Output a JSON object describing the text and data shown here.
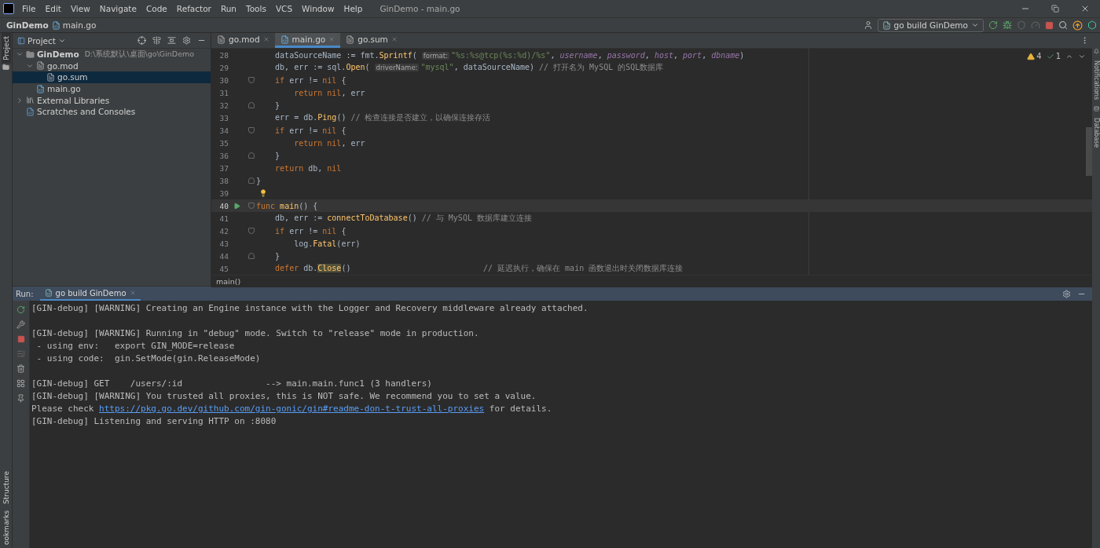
{
  "menu_bar": {
    "items": [
      "File",
      "Edit",
      "View",
      "Navigate",
      "Code",
      "Refactor",
      "Run",
      "Tools",
      "VCS",
      "Window",
      "Help"
    ],
    "title": "GinDemo - main.go"
  },
  "nav_bar": {
    "breadcrumbs": [
      "GinDemo",
      "main.go"
    ],
    "run_config": "go build GinDemo"
  },
  "left_strip": {
    "top": [
      {
        "label": "Project",
        "selected": true
      }
    ],
    "bottom": [
      {
        "label": "Structure",
        "selected": false
      },
      {
        "label": "ookmarks",
        "selected": false
      }
    ]
  },
  "right_strip": [
    {
      "label": "Notifications",
      "kind": "bell"
    },
    {
      "label": "Database",
      "kind": "database"
    }
  ],
  "project_panel": {
    "title": "Project",
    "tree": [
      {
        "label": "GinDemo",
        "path": "D:\\系统默认\\桌面\\go\\GinDemo",
        "kind": "folder",
        "expanded": true,
        "selected": false,
        "bold": true,
        "children": [
          {
            "label": "go.mod",
            "kind": "mod",
            "expanded": true,
            "selected": false,
            "bold": false,
            "children": [
              {
                "label": "go.sum",
                "kind": "mod",
                "selected": true,
                "bold": false
              }
            ]
          },
          {
            "label": "main.go",
            "kind": "gofile",
            "selected": false,
            "bold": false
          }
        ]
      },
      {
        "label": "External Libraries",
        "kind": "library",
        "expanded": false,
        "selected": false,
        "bold": false
      },
      {
        "label": "Scratches and Consoles",
        "kind": "scratch",
        "selected": false,
        "bold": false
      }
    ]
  },
  "editor": {
    "tabs": [
      {
        "label": "go.mod",
        "kind": "mod",
        "selected": false
      },
      {
        "label": "main.go",
        "kind": "gofile",
        "selected": true
      },
      {
        "label": "go.sum",
        "kind": "mod",
        "selected": false
      }
    ],
    "warnings": "4",
    "passed": "1",
    "breadcrumb": "main()",
    "lines": [
      {
        "number": "28",
        "tokens": [
          {
            "kind": "plain",
            "text": "    dataSourceName := fmt."
          },
          {
            "kind": "function",
            "text": "Sprintf"
          },
          {
            "kind": "plain",
            "text": "( "
          },
          {
            "kind": "hint",
            "text": "format:"
          },
          {
            "kind": "string",
            "text": "\"%s:%s@tcp(%s:%d)/%s\""
          },
          {
            "kind": "plain",
            "text": ", "
          },
          {
            "kind": "param",
            "text": "username"
          },
          {
            "kind": "plain",
            "text": ", "
          },
          {
            "kind": "param",
            "text": "password"
          },
          {
            "kind": "plain",
            "text": ", "
          },
          {
            "kind": "param",
            "text": "host"
          },
          {
            "kind": "plain",
            "text": ", "
          },
          {
            "kind": "param",
            "text": "port"
          },
          {
            "kind": "plain",
            "text": ", "
          },
          {
            "kind": "param",
            "text": "dbname"
          },
          {
            "kind": "plain",
            "text": ")"
          }
        ]
      },
      {
        "number": "29",
        "tokens": [
          {
            "kind": "plain",
            "text": "    db, err := sql."
          },
          {
            "kind": "function",
            "text": "Open"
          },
          {
            "kind": "plain",
            "text": "( "
          },
          {
            "kind": "hint",
            "text": "driverName:"
          },
          {
            "kind": "string",
            "text": "\"mysql\""
          },
          {
            "kind": "plain",
            "text": ", dataSourceName) "
          },
          {
            "kind": "comment",
            "text": "// 打开名为 MySQL 的SQL数据库"
          }
        ]
      },
      {
        "number": "30",
        "fold_start": true,
        "tokens": [
          {
            "kind": "keyword",
            "text": "    if"
          },
          {
            "kind": "plain",
            "text": " err != "
          },
          {
            "kind": "keyword",
            "text": "nil"
          },
          {
            "kind": "plain",
            "text": " {"
          }
        ]
      },
      {
        "number": "31",
        "tokens": [
          {
            "kind": "keyword",
            "text": "        return nil"
          },
          {
            "kind": "plain",
            "text": ", err"
          }
        ]
      },
      {
        "number": "32",
        "fold_end": true,
        "tokens": [
          {
            "kind": "plain",
            "text": "    }"
          }
        ]
      },
      {
        "number": "33",
        "tokens": [
          {
            "kind": "plain",
            "text": "    err = db."
          },
          {
            "kind": "function",
            "text": "Ping"
          },
          {
            "kind": "plain",
            "text": "() "
          },
          {
            "kind": "comment",
            "text": "// 检查连接是否建立，以确保连接存活"
          }
        ]
      },
      {
        "number": "34",
        "fold_start": true,
        "tokens": [
          {
            "kind": "keyword",
            "text": "    if"
          },
          {
            "kind": "plain",
            "text": " err != "
          },
          {
            "kind": "keyword",
            "text": "nil"
          },
          {
            "kind": "plain",
            "text": " {"
          }
        ]
      },
      {
        "number": "35",
        "tokens": [
          {
            "kind": "keyword",
            "text": "        return nil"
          },
          {
            "kind": "plain",
            "text": ", err"
          }
        ]
      },
      {
        "number": "36",
        "fold_end": true,
        "tokens": [
          {
            "kind": "plain",
            "text": "    }"
          }
        ]
      },
      {
        "number": "37",
        "tokens": [
          {
            "kind": "keyword",
            "text": "    return"
          },
          {
            "kind": "plain",
            "text": " db, "
          },
          {
            "kind": "keyword",
            "text": "nil"
          }
        ]
      },
      {
        "number": "38",
        "fold_end": true,
        "tokens": [
          {
            "kind": "plain",
            "text": "}"
          }
        ]
      },
      {
        "number": "39",
        "bulb": true
      },
      {
        "number": "40",
        "run": true,
        "current": true,
        "fold_start": true,
        "tokens": [
          {
            "kind": "keyword",
            "text": "func"
          },
          {
            "kind": "function",
            "text": " main"
          },
          {
            "kind": "plain",
            "text": "() {"
          }
        ]
      },
      {
        "number": "41",
        "tokens": [
          {
            "kind": "plain",
            "text": "    db, err := "
          },
          {
            "kind": "function",
            "text": "connectToDatabase"
          },
          {
            "kind": "plain",
            "text": "() "
          },
          {
            "kind": "comment",
            "text": "// 与 MySQL 数据库建立连接"
          }
        ]
      },
      {
        "number": "42",
        "fold_start": true,
        "tokens": [
          {
            "kind": "keyword",
            "text": "    if"
          },
          {
            "kind": "plain",
            "text": " err != "
          },
          {
            "kind": "keyword",
            "text": "nil"
          },
          {
            "kind": "plain",
            "text": " {"
          }
        ]
      },
      {
        "number": "43",
        "tokens": [
          {
            "kind": "plain",
            "text": "        log."
          },
          {
            "kind": "function",
            "text": "Fatal"
          },
          {
            "kind": "plain",
            "text": "(err)"
          }
        ]
      },
      {
        "number": "44",
        "fold_end": true,
        "tokens": [
          {
            "kind": "plain",
            "text": "    }"
          }
        ]
      },
      {
        "number": "45",
        "tokens": [
          {
            "kind": "keyword",
            "text": "    defer"
          },
          {
            "kind": "plain",
            "text": " db."
          },
          {
            "kind": "marked",
            "text": "Close"
          },
          {
            "kind": "plain",
            "text": "()                            "
          },
          {
            "kind": "comment",
            "text": "// 延迟执行，确保在 main 函数退出时关闭数据库连接"
          }
        ]
      }
    ]
  },
  "run_panel": {
    "label": "Run:",
    "tab": "go build GinDemo",
    "lines": [
      {
        "kind": "output",
        "segments": [
          {
            "kind": "text",
            "text": "[GIN-debug] [WARNING] Creating an Engine instance with the Logger and Recovery middleware already attached."
          }
        ]
      },
      {
        "kind": "blank"
      },
      {
        "kind": "output",
        "segments": [
          {
            "kind": "text",
            "text": "[GIN-debug] [WARNING] Running in \"debug\" mode. Switch to \"release\" mode in production."
          }
        ]
      },
      {
        "kind": "output",
        "segments": [
          {
            "kind": "text",
            "text": " - using env:   export GIN_MODE=release"
          }
        ]
      },
      {
        "kind": "output",
        "segments": [
          {
            "kind": "text",
            "text": " - using code:  gin.SetMode(gin.ReleaseMode)"
          }
        ]
      },
      {
        "kind": "blank"
      },
      {
        "kind": "output",
        "segments": [
          {
            "kind": "text",
            "text": "[GIN-debug] GET    /users/:id                --> main.main.func1 (3 handlers)"
          }
        ]
      },
      {
        "kind": "output",
        "segments": [
          {
            "kind": "text",
            "text": "[GIN-debug] [WARNING] You trusted all proxies, this is NOT safe. We recommend you to set a value."
          }
        ]
      },
      {
        "kind": "output",
        "segments": [
          {
            "kind": "text",
            "text": "Please check "
          },
          {
            "kind": "link",
            "text": "https://pkg.go.dev/github.com/gin-gonic/gin#readme-don-t-trust-all-proxies"
          },
          {
            "kind": "text",
            "text": " for details."
          }
        ]
      },
      {
        "kind": "output",
        "segments": [
          {
            "kind": "text",
            "text": "[GIN-debug] Listening and serving HTTP on :8080"
          }
        ]
      }
    ]
  }
}
